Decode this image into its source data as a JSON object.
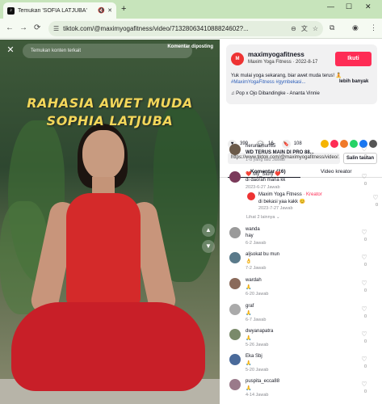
{
  "browser": {
    "tab_title": "Temukan 'SOFIA LATJUBA'",
    "new_tab": "+",
    "url": "tiktok.com/@maximyogafitness/video/7132806341088824602?...",
    "win_min": "—",
    "win_max": "☐",
    "win_close": "✕"
  },
  "video": {
    "search_placeholder": "Temukan konten terkait",
    "report_label": "Komentar diposting",
    "headline_1": "RAHASIA AWET MUDA",
    "headline_2": "SOPHIA LATJUBA"
  },
  "post": {
    "username": "maximyogafitness",
    "subtitle": "Maxim Yoga Fitness · 2022-8-17",
    "follow": "Ikuti",
    "desc_1": "Yuk mulai yoga sekarang, biar awet muda terus! 🧘",
    "desc_2": "#MaximYogaFitness #gymbekasi...",
    "more": "lebih banyak",
    "music": "♫ Pop x Ojo Dibandingke - Ananta Vinnie",
    "likes": "399",
    "comments": "16",
    "saves": "108",
    "link": "https://www.tiktok.com/@maximyogafitness/video/...",
    "copy": "Salin tautan"
  },
  "panel_tabs": {
    "comments": "Komentar (16)",
    "creator_videos": "Video kreator"
  },
  "comment_list": [
    {
      "name": "herunamurf65",
      "text": "WD TERUS MAIN DI PRO 88...",
      "meta": "1-d yang lalu   Jawab",
      "likes": "0"
    },
    {
      "name": "❤️ My_Story ❤️",
      "text": "di daorah mana kk",
      "meta": "2023-6-27   Jawab",
      "likes": "0"
    },
    {
      "name": "wanda",
      "text": "hay",
      "meta": "6-2   Jawab",
      "likes": "0"
    },
    {
      "name": "aljsokat bu mun",
      "text": "👌",
      "meta": "7-2   Jawab",
      "likes": "0"
    },
    {
      "name": "wardah",
      "text": "🙏",
      "meta": "6-20   Jawab",
      "likes": "0"
    },
    {
      "name": "graf",
      "text": "🙏",
      "meta": "6-7   Jawab",
      "likes": "0"
    },
    {
      "name": "dwyanapatra",
      "text": "🙏",
      "meta": "5-26   Jawab",
      "likes": "0"
    },
    {
      "name": "Eka Sbj",
      "text": "🙏",
      "meta": "5-20   Jawab",
      "likes": "0"
    },
    {
      "name": "puspita_ecca88",
      "text": "🙏",
      "meta": "4-14   Jawab",
      "likes": "0"
    }
  ],
  "reply": {
    "name": "Maxim Yoga Fitness",
    "tag": "· Kreator",
    "text": "di bekasi yaa kakk 😊",
    "meta": "2023-7-27   Jawab",
    "likes": "0",
    "see_more": "Lihat 2 lainnya ⌄"
  }
}
